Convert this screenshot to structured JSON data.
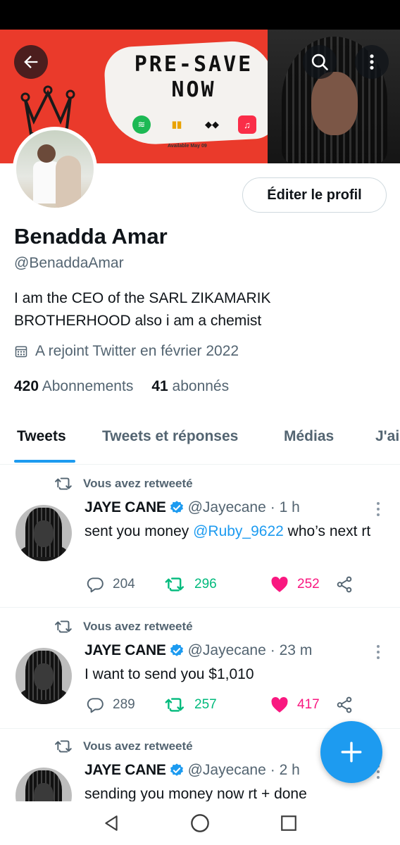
{
  "banner": {
    "headline_line1": "PRE-SAVE",
    "headline_line2": "NOW",
    "available_text": "Available May 09"
  },
  "profile": {
    "edit_label": "Éditer le profil",
    "name": "Benadda Amar",
    "handle": "@BenaddaAmar",
    "bio": "I am the CEO of the SARL ZIKAMARIK BROTHERHOOD also i am a chemist",
    "joined": "A rejoint Twitter en février 2022",
    "following_count": "420",
    "following_label": "Abonnements",
    "followers_count": "41",
    "followers_label": "abonnés"
  },
  "tabs": [
    {
      "label": "Tweets",
      "active": true
    },
    {
      "label": "Tweets et réponses",
      "active": false
    },
    {
      "label": "Médias",
      "active": false
    },
    {
      "label": "J'ai",
      "active": false
    }
  ],
  "tweets": [
    {
      "retweet_label": "Vous avez retweeté",
      "name": "JAYE CANE",
      "handle": "@Jayecane",
      "time": "· 1 h",
      "text_before": "sent you money ",
      "mention": "@Ruby_9622",
      "text_after": " who’s next rt",
      "replies": "204",
      "retweets": "296",
      "likes": "252"
    },
    {
      "retweet_label": "Vous avez retweeté",
      "name": "JAYE CANE",
      "handle": "@Jayecane",
      "time": "· 23 m",
      "text": "I want to send you $1,010",
      "replies": "289",
      "retweets": "257",
      "likes": "417"
    },
    {
      "retweet_label": "Vous avez retweeté",
      "name": "JAYE CANE",
      "handle": "@Jayecane",
      "time": "· 2 h",
      "text": "sending you money now rt + done"
    }
  ],
  "colors": {
    "accent": "#1d9bf0",
    "retweet": "#00ba7c",
    "like": "#f91880",
    "banner": "#ea3a2b"
  }
}
